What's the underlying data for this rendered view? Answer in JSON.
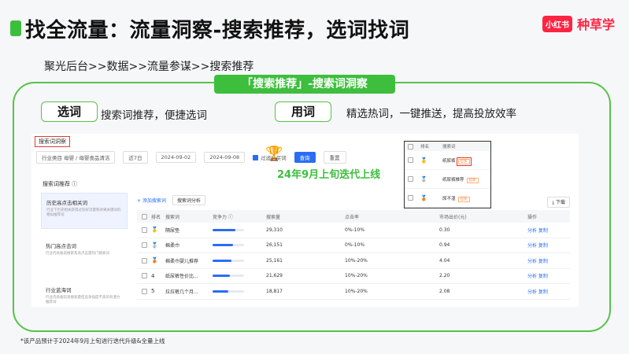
{
  "title": "找全流量：流量洞察-搜索推荐，选词找词",
  "brand": {
    "logo": "小红书",
    "name": "种草学"
  },
  "path": "聚光后台>>数据>>流量参谋>>搜索推荐",
  "frame_tag": "「搜索推荐」-搜索词洞察",
  "select": {
    "label": "选词",
    "desc": "搜索词推荐，便捷选词"
  },
  "use": {
    "label": "用词",
    "desc": "精选热词，一键推送，提高投放效率"
  },
  "screenshot": {
    "title": "搜索词洞察",
    "filters": {
      "industry": "行业类目  母婴 / 母婴食品清洁",
      "period": "近7日",
      "date_start": "2024-09-02",
      "date_end": "2024-09-08",
      "exclude_label": "过滤已买词",
      "query_button": "查询",
      "reset_button": "重置"
    },
    "update_note": "24年9月上旬迭代上线",
    "side_title": "搜索词推荐 ⓘ",
    "side_items": [
      {
        "label": "历史高点击相关词",
        "sub": "行业下历史相关获得过较好流量和效果关键词的相似推荐词",
        "active": true
      },
      {
        "label": "热门高点击词",
        "sub": "行业内具备高搜索及高点击量热门搜索词",
        "active": false
      },
      {
        "label": "行业蓝海词",
        "sub": "行业内具备较高搜索量但竞争强度不高的有潜力推荐词",
        "active": false
      }
    ],
    "toolbar": {
      "add": "+ 添加搜索词",
      "analysis": "搜索词分析",
      "download": "下载"
    },
    "columns": [
      "",
      "排名",
      "搜索词",
      "竞争力 ⓘ",
      "搜索量",
      "点击率",
      "市场出价(元)",
      "操作"
    ],
    "rows": [
      {
        "rank": "🥇",
        "word": "隔尿垫",
        "competition": 0.72,
        "volume": "29,310",
        "ctr": "0%-10%",
        "bid": "0.30",
        "op": "分析 复制"
      },
      {
        "rank": "🥈",
        "word": "棉柔巾",
        "competition": 0.65,
        "volume": "26,151",
        "ctr": "0%-10%",
        "bid": "0.94",
        "op": "分析 复制"
      },
      {
        "rank": "🥉",
        "word": "棉柔巾婴儿推荐",
        "competition": 0.6,
        "volume": "25,161",
        "ctr": "10%-20%",
        "bid": "4.04",
        "op": "分析 复制"
      },
      {
        "rank": "4",
        "word": "纸尿裤性价比...",
        "competition": 0.55,
        "volume": "21,629",
        "ctr": "10%-20%",
        "bid": "2.20",
        "op": "分析 复制"
      },
      {
        "rank": "5",
        "word": "拉拉裤几个月...",
        "competition": 0.5,
        "volume": "18,817",
        "ctr": "10%-20%",
        "bid": "2.08",
        "op": "分析 复制"
      }
    ],
    "popup": {
      "columns": [
        "",
        "排名",
        "搜索词"
      ],
      "rows": [
        {
          "rank": "🥇",
          "word": "纸尿裤",
          "tag": "已买",
          "highlight": true
        },
        {
          "rank": "🥈",
          "word": "纸尿裤推荐",
          "tag": "已买",
          "highlight": false
        },
        {
          "rank": "🥉",
          "word": "尿不湿",
          "tag": "已买",
          "highlight": false
        }
      ]
    }
  },
  "footnote": "*该产品预计于2024年9月上旬进行迭代升级&全量上线",
  "colors": {
    "accent": "#3dbf3d",
    "brand": "#ff2442",
    "link": "#2a6df4"
  }
}
